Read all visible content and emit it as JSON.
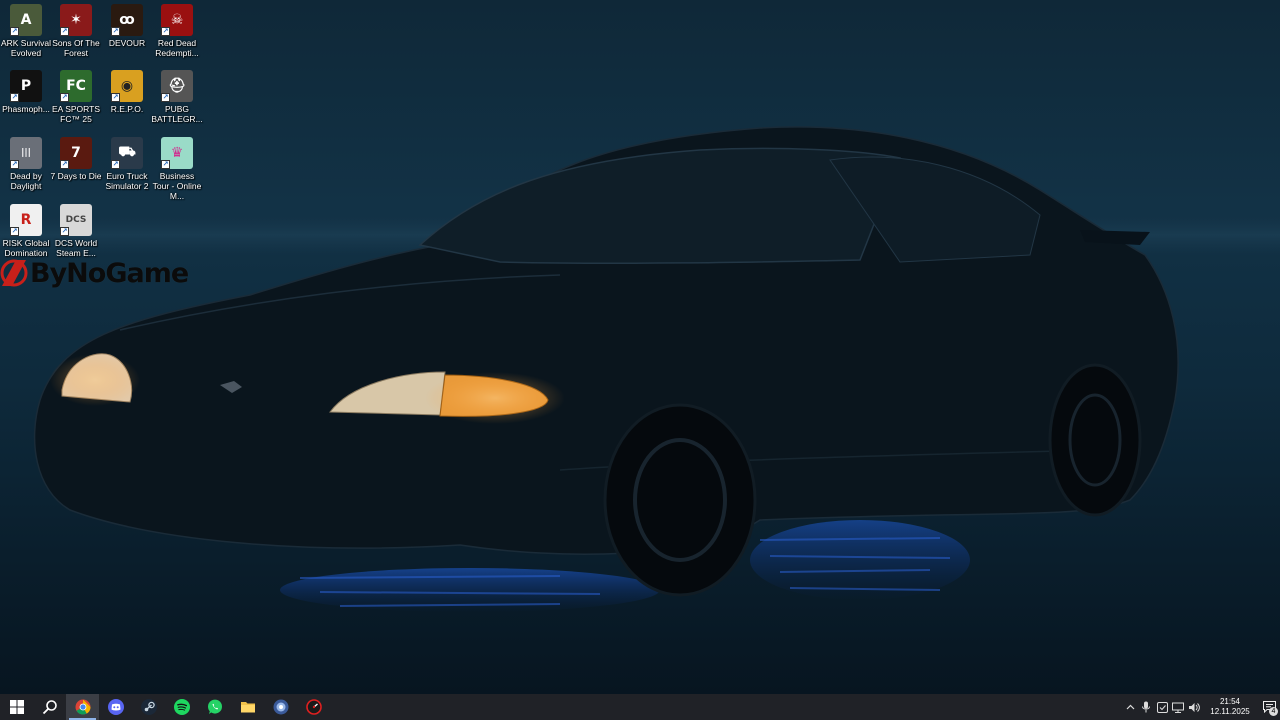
{
  "desktop": {
    "icons": [
      {
        "label": "ARK Survival Evolved",
        "icon": "ark-icon",
        "color": "#4a5a3a"
      },
      {
        "label": "Sons Of The Forest",
        "icon": "sons-of-the-forest-icon",
        "color": "#8a1a1a"
      },
      {
        "label": "DEVOUR",
        "icon": "devour-icon",
        "color": "#2a1a10"
      },
      {
        "label": "Red Dead Redempti...",
        "icon": "red-dead-icon",
        "color": "#9a1010"
      },
      {
        "label": "Phasmoph...",
        "icon": "phasmophobia-icon",
        "color": "#111111"
      },
      {
        "label": "EA SPORTS FC™ 25",
        "icon": "ea-fc-icon",
        "color": "#2d6b2d"
      },
      {
        "label": "R.E.P.O.",
        "icon": "repo-icon",
        "color": "#d9a020"
      },
      {
        "label": "PUBG BATTLEGR...",
        "icon": "pubg-icon",
        "color": "#555555"
      },
      {
        "label": "Dead by Daylight",
        "icon": "dead-by-daylight-icon",
        "color": "#6a6f78"
      },
      {
        "label": "7 Days to Die",
        "icon": "7-days-to-die-icon",
        "color": "#5a1a10"
      },
      {
        "label": "Euro Truck Simulator 2",
        "icon": "euro-truck-icon",
        "color": "#2a3a4a"
      },
      {
        "label": "Business Tour - Online M...",
        "icon": "business-tour-icon",
        "color": "#9adbc8"
      },
      {
        "label": "RISK Global Domination",
        "icon": "risk-icon",
        "color": "#f0f0f0"
      },
      {
        "label": "DCS World Steam E...",
        "icon": "dcs-icon",
        "color": "#d8d8d8"
      }
    ]
  },
  "watermark": {
    "text": "ByNoGame",
    "icon": "bynogame-logo-icon"
  },
  "taskbar": {
    "apps": [
      {
        "name": "start-button",
        "icon": "windows-icon"
      },
      {
        "name": "search-button",
        "icon": "search-icon"
      },
      {
        "name": "chrome-button",
        "icon": "chrome-icon",
        "active": true
      },
      {
        "name": "discord-button",
        "icon": "discord-icon"
      },
      {
        "name": "steam-button",
        "icon": "steam-icon"
      },
      {
        "name": "spotify-button",
        "icon": "spotify-icon"
      },
      {
        "name": "whatsapp-button",
        "icon": "whatsapp-icon"
      },
      {
        "name": "file-explorer-button",
        "icon": "folder-icon"
      },
      {
        "name": "app-8-button",
        "icon": "app-circle-icon"
      },
      {
        "name": "app-9-button",
        "icon": "speedometer-icon"
      }
    ],
    "tray": {
      "time": "21:54",
      "date": "12.11.2025",
      "notification_count": "4"
    }
  }
}
